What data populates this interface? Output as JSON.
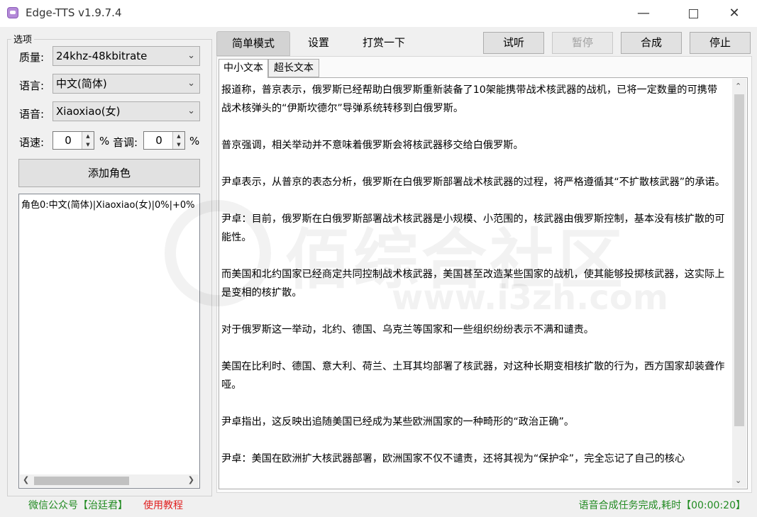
{
  "window": {
    "title": "Edge-TTS v1.9.7.4",
    "min_glyph": "—",
    "close_glyph": "✕"
  },
  "options": {
    "group_title": "选项",
    "quality_label": "质量:",
    "quality_value": "24khz-48kbitrate",
    "language_label": "语言:",
    "language_value": "中文(简体)",
    "voice_label": "语音:",
    "voice_value": "Xiaoxiao(女)",
    "rate_label": "语速:",
    "rate_value": "0",
    "rate_unit": "%",
    "pitch_label": "音调:",
    "pitch_value": "0",
    "pitch_unit": "%",
    "add_role_label": "添加角色",
    "roles": [
      "角色0:中文(简体)|Xiaoxiao(女)|0%|+0%"
    ]
  },
  "tabs": {
    "simple": "简单模式",
    "settings": "设置",
    "donate": "打赏一下"
  },
  "actions": {
    "preview": "试听",
    "pause": "暂停",
    "synthesize": "合成",
    "stop": "停止"
  },
  "subtabs": {
    "short": "中小文本",
    "long": "超长文本"
  },
  "editor": {
    "paragraphs": [
      "报道称，普京表示，俄罗斯已经帮助白俄罗斯重新装备了10架能携带战术核武器的战机，已将一定数量的可携带战术核弹头的“伊斯坎德尔”导弹系统转移到白俄罗斯。",
      "普京强调，相关举动并不意味着俄罗斯会将核武器移交给白俄罗斯。",
      "尹卓表示，从普京的表态分析，俄罗斯在白俄罗斯部署战术核武器的过程，将严格遵循其“不扩散核武器”的承诺。",
      "尹卓：目前，俄罗斯在白俄罗斯部署战术核武器是小规模、小范围的，核武器由俄罗斯控制，基本没有核扩散的可能性。",
      "而美国和北约国家已经商定共同控制战术核武器，美国甚至改造某些国家的战机，使其能够投掷核武器，这实际上是变相的核扩散。",
      "对于俄罗斯这一举动，北约、德国、乌克兰等国家和一些组织纷纷表示不满和谴责。",
      "美国在比利时、德国、意大利、荷兰、土耳其均部署了核武器，对这种长期变相核扩散的行为，西方国家却装聋作哑。",
      "尹卓指出，这反映出追随美国已经成为某些欧洲国家的一种畸形的“政治正确”。",
      "尹卓：美国在欧洲扩大核武器部署，欧洲国家不仅不谴责，还将其视为“保护伞”，完全忘记了自己的核心"
    ]
  },
  "watermark": {
    "text": "佰综合社区",
    "url": "www.i3zh.com"
  },
  "status": {
    "wechat": "微信公众号【治廷君】",
    "tutorial": "使用教程",
    "message": "语音合成任务完成,耗时【00:00:20】"
  }
}
